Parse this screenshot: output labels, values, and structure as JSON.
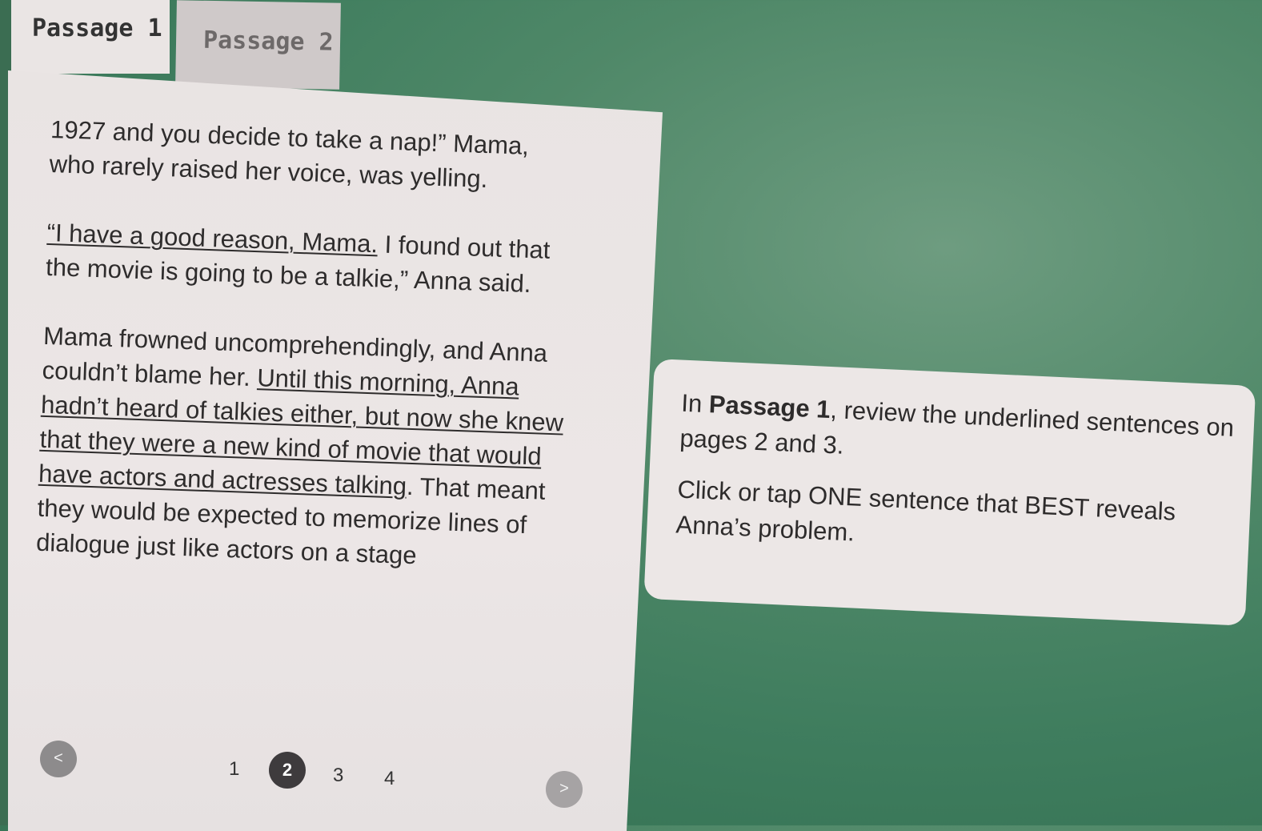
{
  "tabs": [
    {
      "label": "Passage 1",
      "active": true
    },
    {
      "label": "Passage 2",
      "active": false
    }
  ],
  "passage": {
    "p1": "1927 and you decide to take a nap!” Mama, who rarely raised her voice, was yelling.",
    "p2_underlined": "“I have a good reason, Mama.",
    "p2_rest": " I found out that the movie is going to be a talkie,” Anna said.",
    "p3_start": "Mama frowned uncomprehendingly, and Anna couldn’t blame her. ",
    "p3_underlined": "Until this morning, Anna hadn’t heard of talkies either, but now she knew that they were a new kind of movie that would have actors and actresses talking",
    "p3_end": ". That meant they would be expected to memorize lines of dialogue just like actors on a stage"
  },
  "prompt": {
    "line1_pre": "In ",
    "line1_bold": "Passage 1",
    "line1_post": ", review the underlined sentences on pages 2 and 3.",
    "line2": "Click or tap ONE sentence that BEST reveals Anna’s problem."
  },
  "pagination": {
    "prev": "<",
    "next": ">",
    "pages": [
      "1",
      "2",
      "3",
      "4"
    ],
    "current": "2"
  },
  "colors": {
    "background": "#4f8868",
    "panel": "#eae5e4",
    "current_page": "#3e3b3d"
  }
}
